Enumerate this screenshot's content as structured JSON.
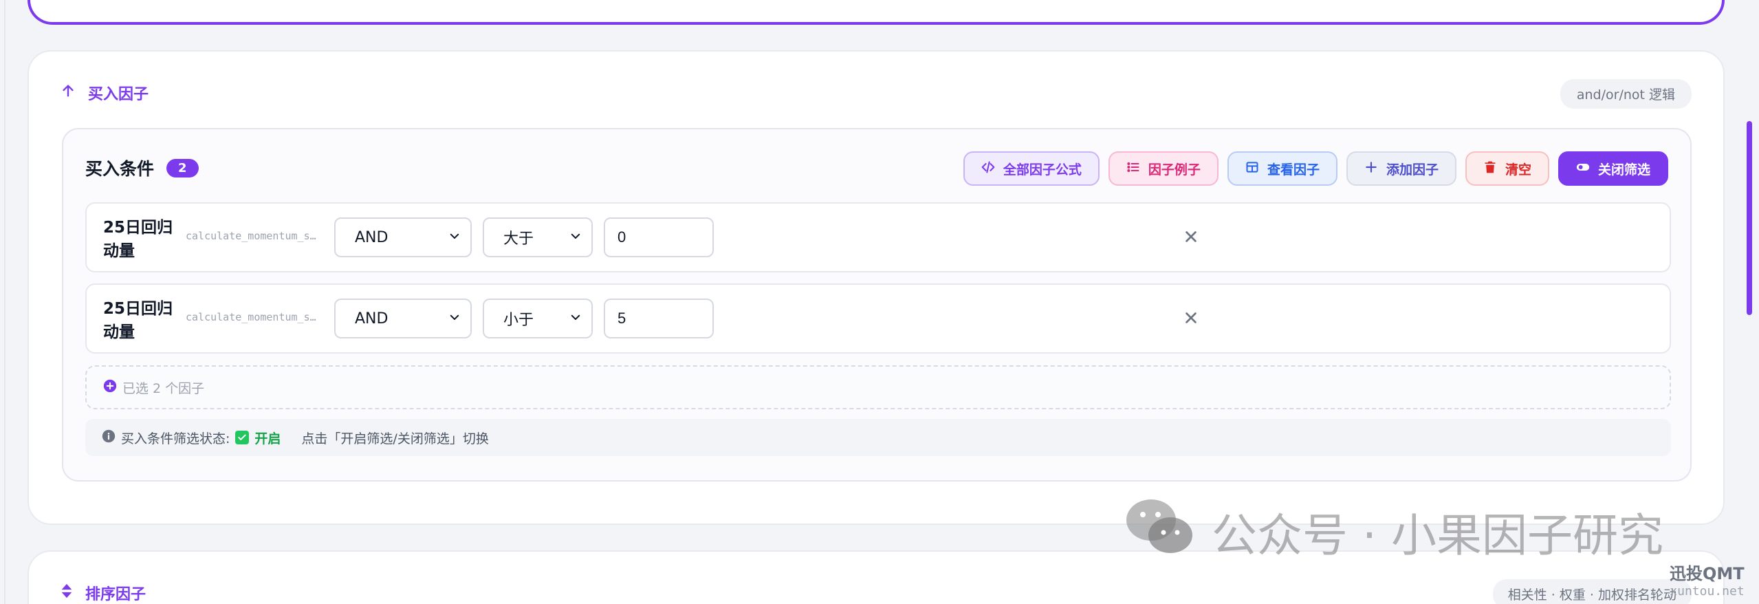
{
  "buy_factor_section": {
    "title": "买入因子",
    "logic_hint": "and/or/not 逻辑",
    "panel": {
      "title": "买入条件",
      "count": "2",
      "toolbar": {
        "all_formulas": "全部因子公式",
        "factor_examples": "因子例子",
        "view_factors": "查看因子",
        "add_factor": "添加因子",
        "clear": "清空",
        "close_filter": "关闭筛选"
      },
      "conditions": [
        {
          "name": "25日回归动量",
          "function": "calculate_momentum_s…",
          "logic": "AND",
          "operator": "大于",
          "value": "0"
        },
        {
          "name": "25日回归动量",
          "function": "calculate_momentum_s…",
          "logic": "AND",
          "operator": "小于",
          "value": "5"
        }
      ],
      "selected_summary": "已选 2 个因子",
      "status": {
        "label": "买入条件筛选状态:",
        "state": "开启",
        "hint": "点击「开启筛选/关闭筛选」切换"
      }
    }
  },
  "sort_factor_section": {
    "title": "排序因子",
    "hint": "相关性 · 权重 · 加权排名轮动"
  },
  "watermark": {
    "text": "公众号 · 小果因子研究",
    "corner_title": "迅投QMT",
    "corner_url": "xuntou.net"
  },
  "colors": {
    "accent": "#7c3aed",
    "success": "#16a34a",
    "danger": "#dc2626",
    "info": "#2563eb",
    "pink": "#db2777"
  }
}
